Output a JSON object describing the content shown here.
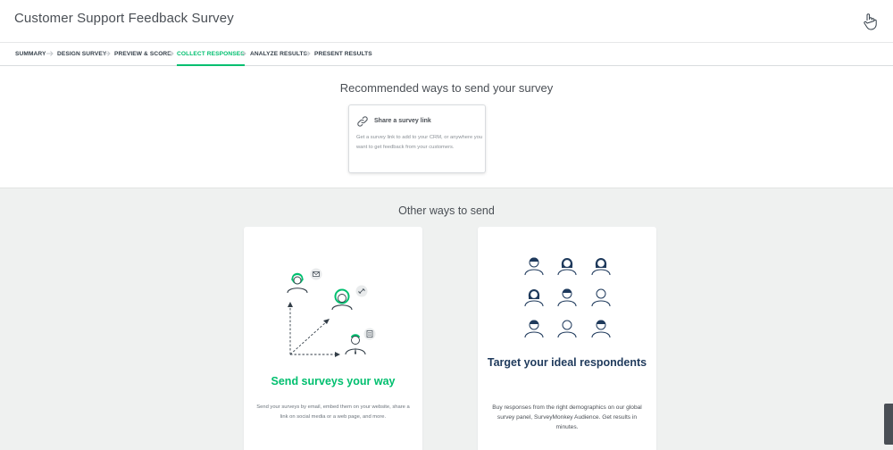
{
  "header": {
    "title": "Customer Support Feedback Survey"
  },
  "nav": {
    "items": [
      {
        "label": "SUMMARY"
      },
      {
        "label": "DESIGN SURVEY"
      },
      {
        "label": "PREVIEW & SCORE"
      },
      {
        "label": "COLLECT RESPONSES"
      },
      {
        "label": "ANALYZE RESULTS"
      },
      {
        "label": "PRESENT RESULTS"
      }
    ],
    "active_index": 3
  },
  "recommended": {
    "title": "Recommended ways to send your survey",
    "card": {
      "icon": "link-icon",
      "title": "Share a survey link",
      "description": "Get a survey link to add to your CRM, or anywhere you want to get feedback from your customers."
    }
  },
  "other": {
    "title": "Other ways to send",
    "cards": [
      {
        "heading": "Send surveys your way",
        "description": "Send your surveys by email, embed them on your website, share a link on social media or a web page, and more."
      },
      {
        "heading": "Target your ideal respondents",
        "description": "Buy responses from the right demographics on our global survey panel, SurveyMonkey Audience. Get results in minutes."
      }
    ]
  },
  "colors": {
    "accent_green": "#00bf6f",
    "navy": "#1f3a5c",
    "text": "#333e48",
    "background_gray": "#eff1f0"
  }
}
